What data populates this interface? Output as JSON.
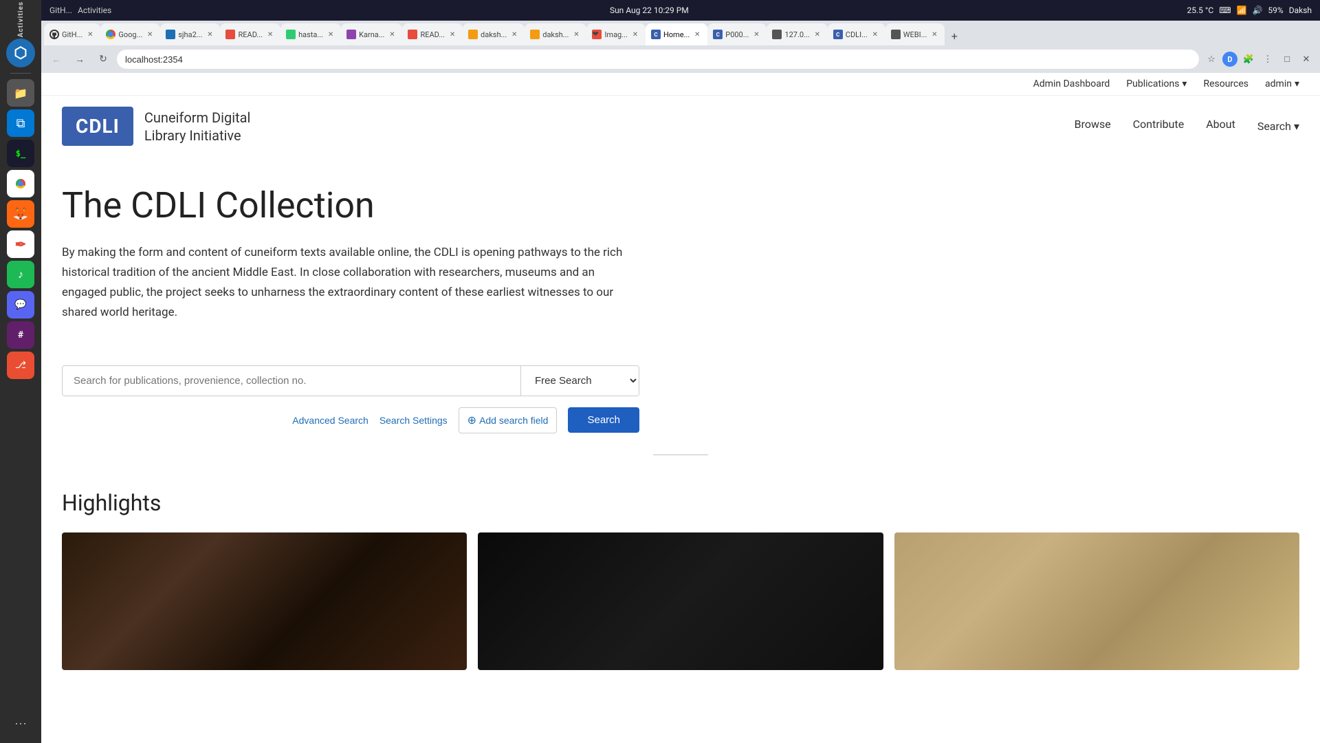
{
  "system": {
    "activities_label": "Activities",
    "datetime": "Sun Aug 22  10:29 PM",
    "temperature": "25.5 °C",
    "battery": "59%",
    "username": "Daksh"
  },
  "browser": {
    "url": "localhost:2354",
    "tabs": [
      {
        "id": "github",
        "label": "GitH...",
        "favicon_color": "#333",
        "active": false,
        "closeable": true
      },
      {
        "id": "google",
        "label": "Goog...",
        "favicon_color": "#4285f4",
        "active": false,
        "closeable": true
      },
      {
        "id": "sjha2",
        "label": "sjha2...",
        "favicon_color": "#1e6eb5",
        "active": false,
        "closeable": true
      },
      {
        "id": "read1",
        "label": "READ...",
        "favicon_color": "#e74c3c",
        "active": false,
        "closeable": true
      },
      {
        "id": "hasta",
        "label": "hasta...",
        "favicon_color": "#2ecc71",
        "active": false,
        "closeable": true
      },
      {
        "id": "karna",
        "label": "Karna...",
        "favicon_color": "#8e44ad",
        "active": false,
        "closeable": true
      },
      {
        "id": "read2",
        "label": "READ...",
        "favicon_color": "#e74c3c",
        "active": false,
        "closeable": true
      },
      {
        "id": "daksh1",
        "label": "daksh...",
        "favicon_color": "#f39c12",
        "active": false,
        "closeable": true
      },
      {
        "id": "daksh2",
        "label": "daksh...",
        "favicon_color": "#f39c12",
        "active": false,
        "closeable": true
      },
      {
        "id": "imag",
        "label": "Imag...",
        "favicon_color": "#e74c3c",
        "active": false,
        "closeable": true
      },
      {
        "id": "home",
        "label": "Home...",
        "favicon_color": "#3a5fad",
        "active": true,
        "closeable": true
      },
      {
        "id": "p000",
        "label": "P000...",
        "favicon_color": "#3a5fad",
        "active": false,
        "closeable": true
      },
      {
        "id": "127",
        "label": "127.0...",
        "favicon_color": "#555",
        "active": false,
        "closeable": true
      },
      {
        "id": "cdli",
        "label": "CDLI...",
        "favicon_color": "#3a5fad",
        "active": false,
        "closeable": true
      },
      {
        "id": "webi",
        "label": "WEBI...",
        "favicon_color": "#555",
        "active": false,
        "closeable": true
      }
    ]
  },
  "admin_nav": {
    "admin_dashboard_label": "Admin Dashboard",
    "publications_label": "Publications",
    "resources_label": "Resources",
    "admin_label": "admin"
  },
  "main_nav": {
    "browse_label": "Browse",
    "contribute_label": "Contribute",
    "about_label": "About",
    "search_label": "Search"
  },
  "logo": {
    "acronym": "CDLI",
    "title_line1": "Cuneiform Digital",
    "title_line2": "Library Initiative"
  },
  "hero": {
    "title": "The CDLI Collection",
    "description": "By making the form and content of cuneiform texts available online, the CDLI is opening pathways to the rich historical tradition of the ancient Middle East. In close collaboration with researchers, museums and an engaged public, the project seeks to unharness the extraordinary content of these earliest witnesses to our shared world heritage."
  },
  "search": {
    "input_placeholder": "Search for publications, provenience, collection no.",
    "input_value": "",
    "dropdown_options": [
      {
        "value": "free",
        "label": "Free Search"
      },
      {
        "value": "advanced",
        "label": "Advanced Search"
      }
    ],
    "selected_option": "Free Search",
    "advanced_search_label": "Advanced Search",
    "search_settings_label": "Search Settings",
    "add_field_label": "Add search field",
    "search_btn_label": "Search"
  },
  "highlights": {
    "title": "Highlights",
    "cards": [
      {
        "id": "card1",
        "color1": "#2a1a0a",
        "color2": "#4a3020"
      },
      {
        "id": "card2",
        "color1": "#0a0a0a",
        "color2": "#1a1a1a"
      },
      {
        "id": "card3",
        "color1": "#b8a070",
        "color2": "#c8b080"
      }
    ]
  },
  "taskbar_icons": [
    {
      "name": "files-icon",
      "symbol": "📁",
      "bg": "#555"
    },
    {
      "name": "vscode-icon",
      "symbol": "⬡",
      "bg": "#0078d4"
    },
    {
      "name": "terminal-icon",
      "symbol": ">_",
      "bg": "#1a1a2e"
    },
    {
      "name": "chrome-icon",
      "symbol": "◉",
      "bg": "#fff"
    },
    {
      "name": "firefox-icon",
      "symbol": "🦊",
      "bg": "#ff6611"
    },
    {
      "name": "inkscape-icon",
      "symbol": "✒",
      "bg": "#fff"
    },
    {
      "name": "spotify-icon",
      "symbol": "♪",
      "bg": "#1db954"
    },
    {
      "name": "discord-icon",
      "symbol": "🎮",
      "bg": "#5865f2"
    },
    {
      "name": "slack-icon",
      "symbol": "#",
      "bg": "#611f69"
    },
    {
      "name": "git-icon",
      "symbol": "⎇",
      "bg": "#e94e32"
    },
    {
      "name": "apps-icon",
      "symbol": "⋯",
      "bg": "transparent"
    }
  ]
}
